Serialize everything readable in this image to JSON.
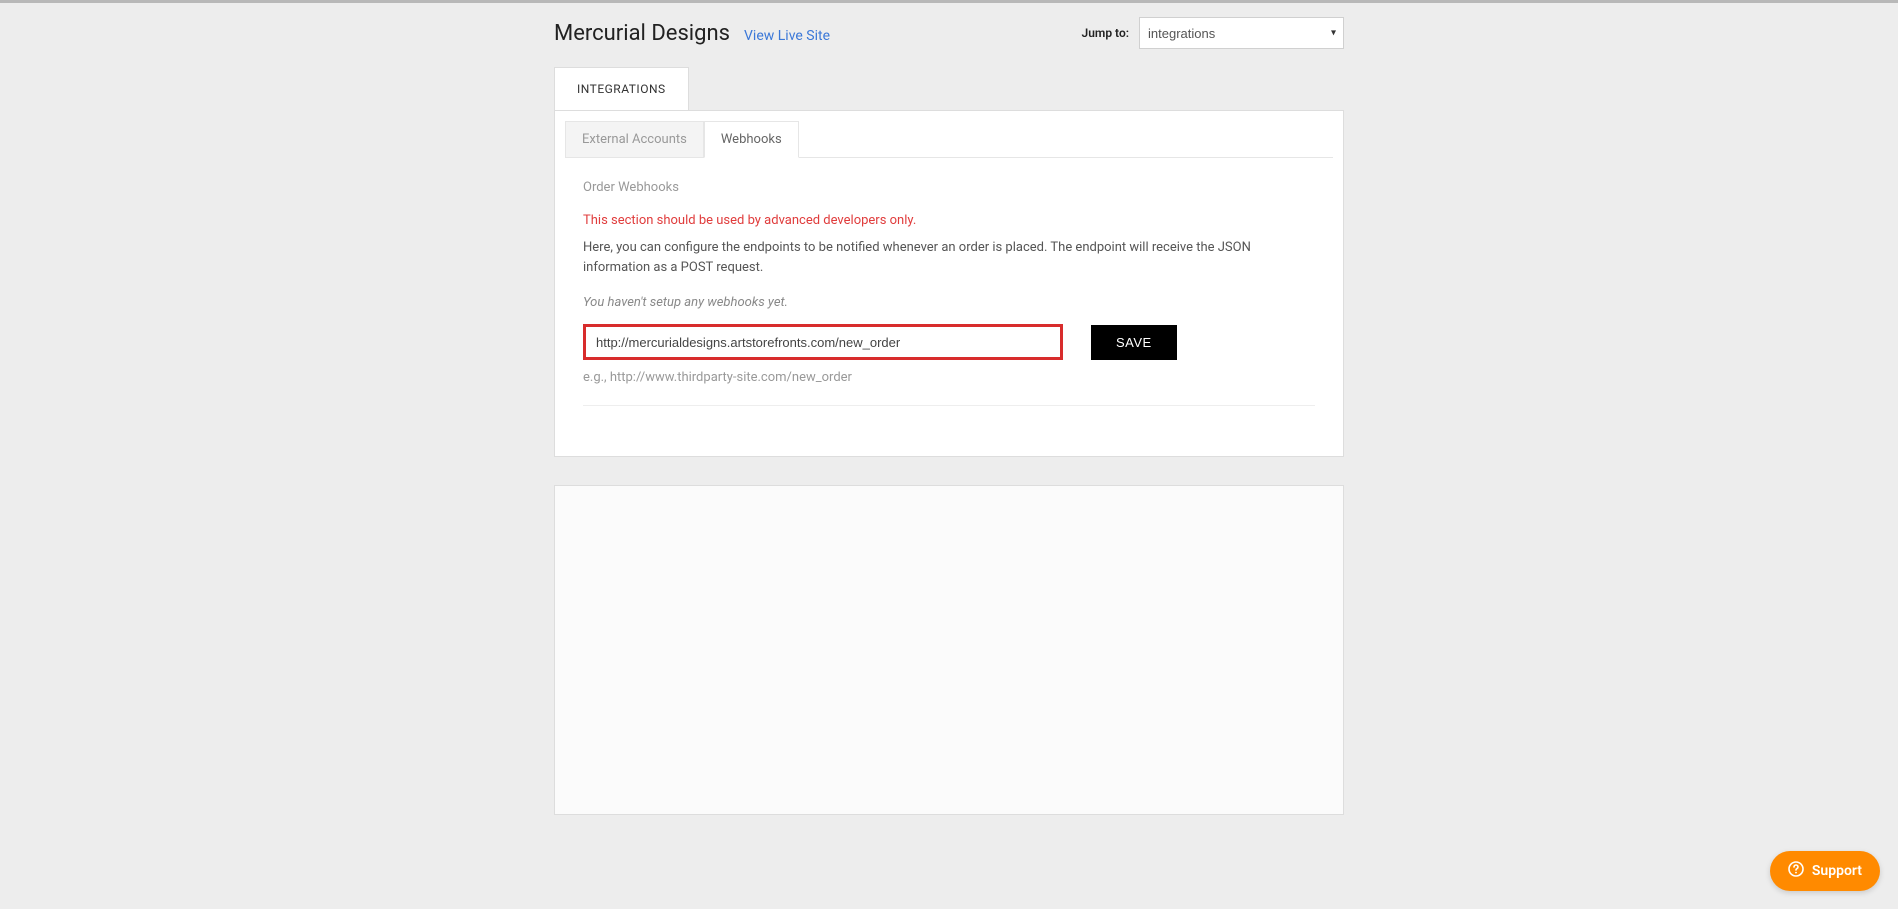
{
  "header": {
    "site_title": "Mercurial Designs",
    "view_live": "View Live Site",
    "jump_to_label": "Jump to:",
    "jump_to_selected": "integrations"
  },
  "tabs": {
    "outer": {
      "integrations": "INTEGRATIONS"
    },
    "sub": {
      "external_accounts": "External Accounts",
      "webhooks": "Webhooks"
    }
  },
  "webhooks": {
    "section_label": "Order Webhooks",
    "warning": "This section should be used by advanced developers only.",
    "description": "Here, you can configure the endpoints to be notified whenever an order is placed. The endpoint will receive the JSON information as a POST request.",
    "empty_msg": "You haven't setup any webhooks yet.",
    "input_value": "http://mercurialdesigns.artstorefronts.com/new_order",
    "example": "e.g., http://www.thirdparty-site.com/new_order",
    "save_label": "SAVE"
  },
  "support": {
    "label": "Support"
  }
}
